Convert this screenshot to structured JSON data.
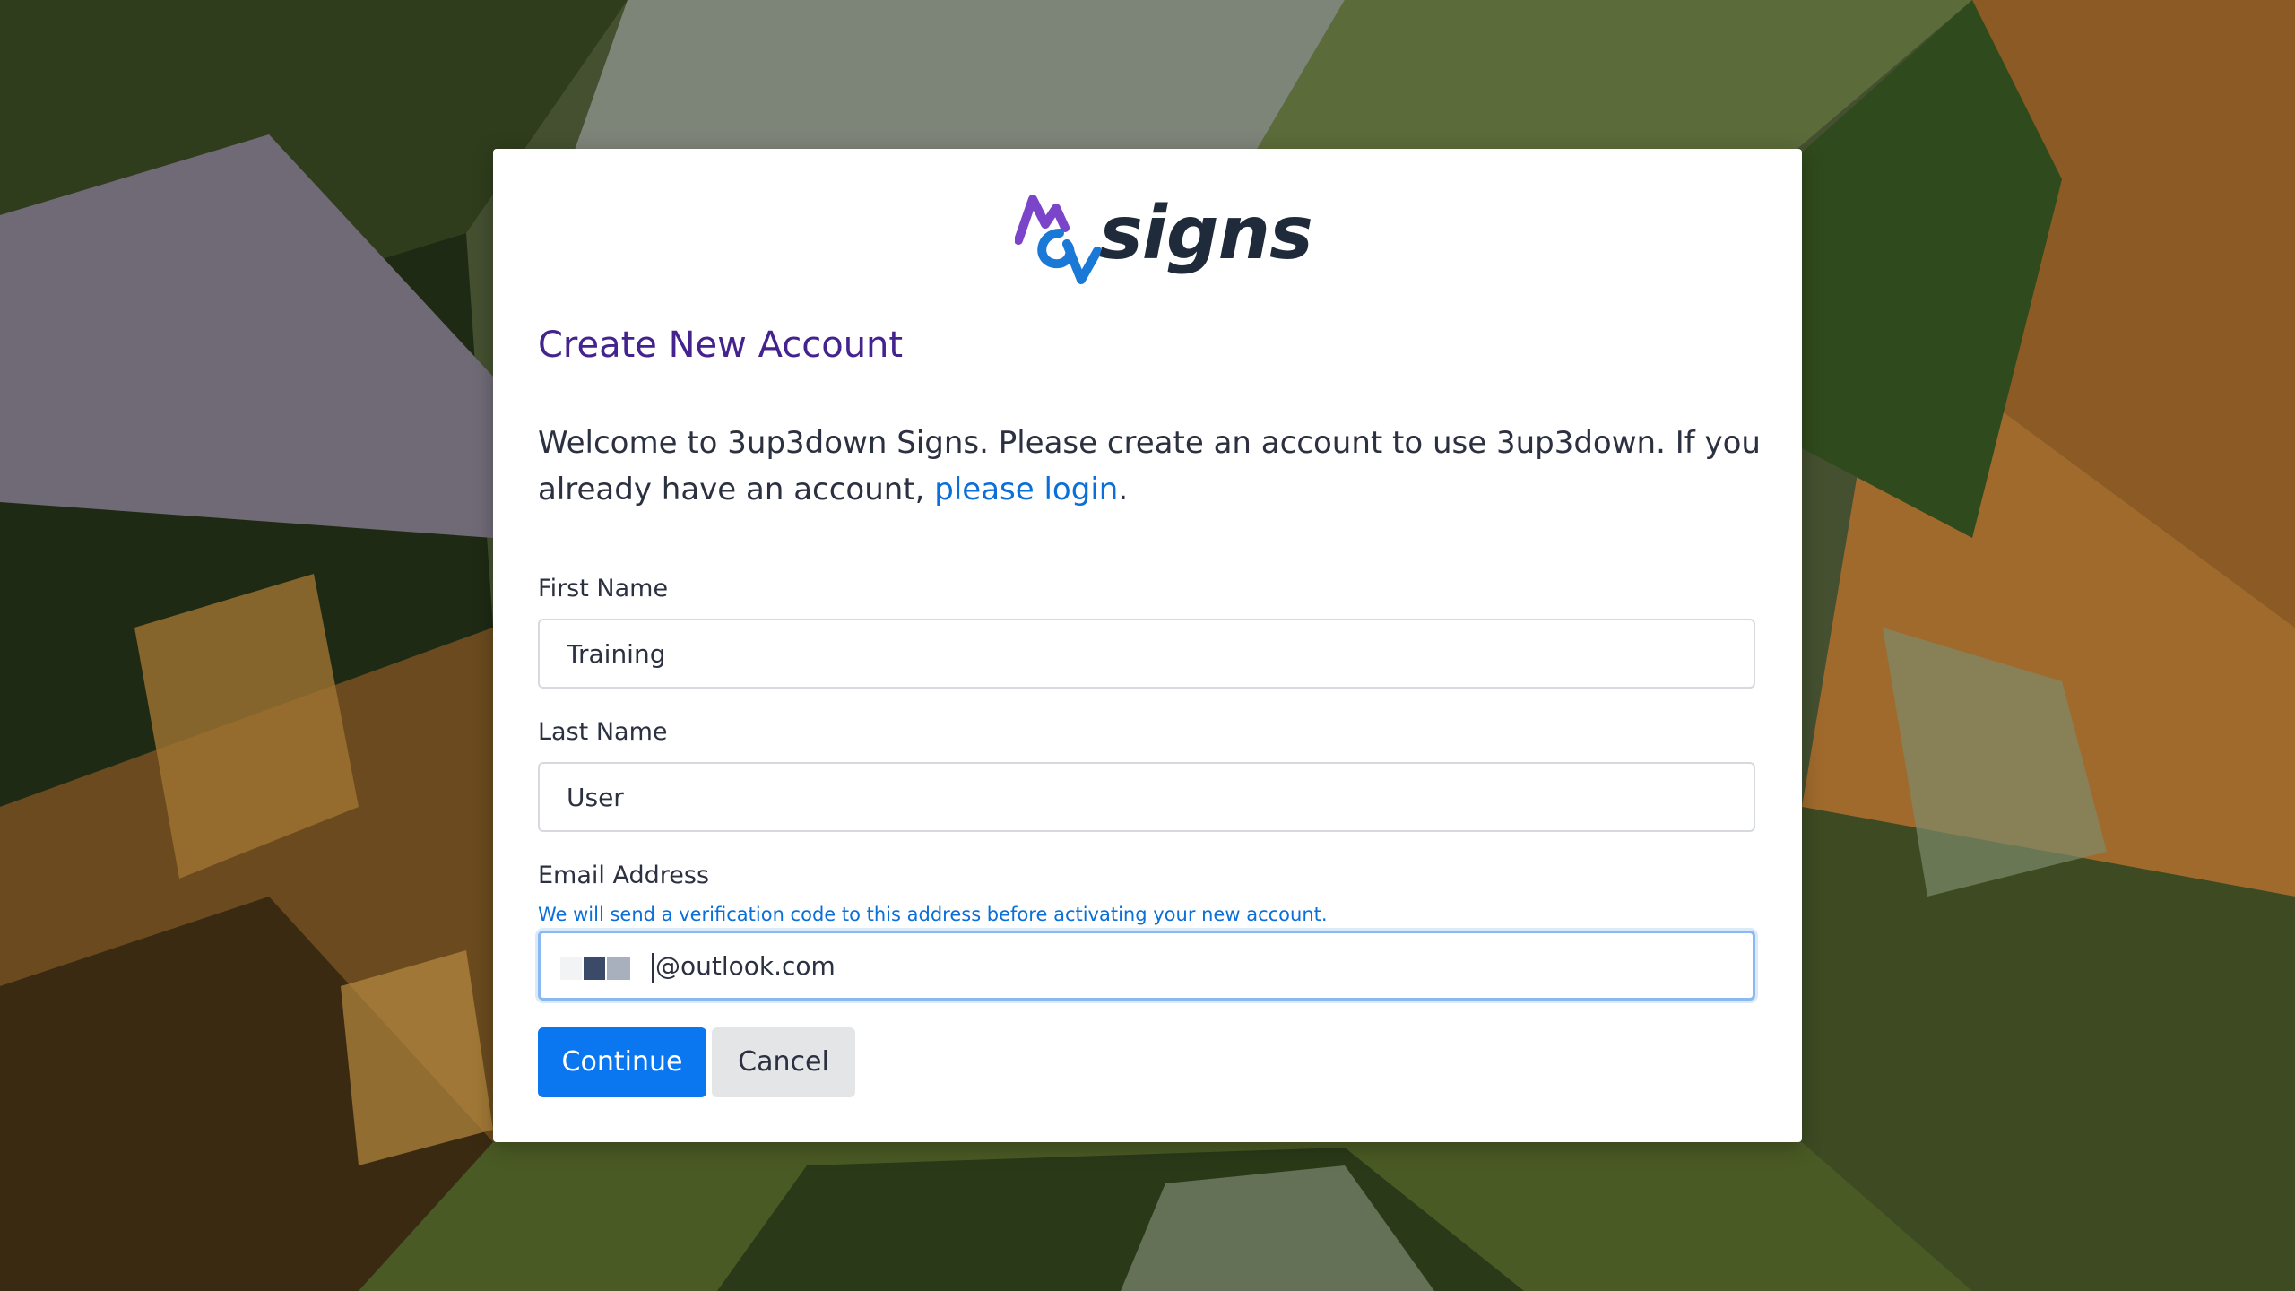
{
  "brand": {
    "name": "signs",
    "colors": {
      "purple": "#7b45c9",
      "blue": "#1a78d6",
      "dark": "#1f2a3a"
    }
  },
  "form": {
    "title": "Create New Account",
    "intro_text": "Welcome to 3up3down Signs. Please create an account to use 3up3down. If you already have an account, ",
    "login_link": "please login",
    "intro_end": ".",
    "first_name": {
      "label": "First Name",
      "value": "Training"
    },
    "last_name": {
      "label": "Last Name",
      "value": "User"
    },
    "email": {
      "label": "Email Address",
      "hint": "We will send a verification code to this address before activating your new account.",
      "value_visible": "@outlook.com"
    },
    "buttons": {
      "continue": "Continue",
      "cancel": "Cancel"
    }
  },
  "colors": {
    "title": "#45238f",
    "link": "#0a6fd8",
    "primary_button": "#0a76f0",
    "secondary_button": "#e4e5e7"
  }
}
